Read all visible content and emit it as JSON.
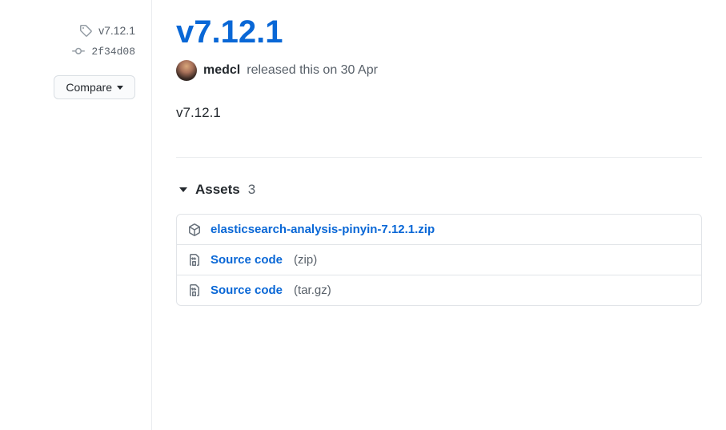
{
  "sidebar": {
    "tag": "v7.12.1",
    "commit": "2f34d08",
    "compare_label": "Compare"
  },
  "release": {
    "title": "v7.12.1",
    "author": "medcl",
    "released_text": "released this on 30 Apr",
    "body": "v7.12.1"
  },
  "assets": {
    "label": "Assets",
    "count": "3",
    "items": [
      {
        "name": "elasticsearch-analysis-pinyin-7.12.1.zip",
        "ext": "",
        "icon": "package"
      },
      {
        "name": "Source code",
        "ext": "(zip)",
        "icon": "zip"
      },
      {
        "name": "Source code",
        "ext": "(tar.gz)",
        "icon": "zip"
      }
    ]
  }
}
